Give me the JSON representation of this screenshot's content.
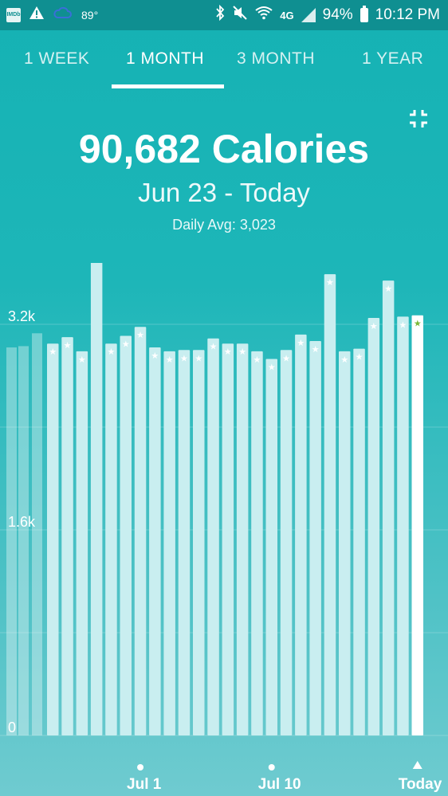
{
  "status_bar": {
    "imdb_label": "IMDb",
    "temperature": "89°",
    "network": "4G",
    "battery": "94%",
    "time": "10:12 PM"
  },
  "tabs": [
    {
      "label": "1 WEEK",
      "active": false
    },
    {
      "label": "1 MONTH",
      "active": true
    },
    {
      "label": "3 MONTH",
      "active": false
    },
    {
      "label": "1 YEAR",
      "active": false
    }
  ],
  "summary": {
    "total": "90,682 Calories",
    "range": "Jun 23 - Today",
    "daily_avg_label": "Daily Avg:",
    "daily_avg_value": "3,023"
  },
  "colors": {
    "accent": "#15b2b4",
    "bar": "#c9eef0",
    "today_bar": "#ffffff",
    "star_today": "#7ab836"
  },
  "chart_data": {
    "type": "bar",
    "y_ticks": [
      {
        "label": "3.2k",
        "value": 3200
      },
      {
        "label": "1.6k",
        "value": 1600
      },
      {
        "label": "0",
        "value": 0
      }
    ],
    "x_labels": [
      {
        "label": "Jul 1",
        "index": 6
      },
      {
        "label": "Jul 10",
        "index": 15
      },
      {
        "label": "Today",
        "index": 25
      }
    ],
    "values": [
      3050,
      3100,
      2990,
      3830,
      3050,
      3110,
      3180,
      3020,
      2990,
      3000,
      3000,
      3090,
      3050,
      3050,
      2990,
      2930,
      3000,
      3120,
      3070,
      3590,
      2990,
      3010,
      3250,
      3540,
      3260,
      3270
    ],
    "ylim": [
      0,
      3900
    ],
    "goal_met": [
      true,
      true,
      true,
      true,
      true,
      true,
      true,
      true,
      true,
      true,
      true,
      true,
      true,
      true,
      true,
      true,
      true,
      true,
      true,
      true,
      true,
      true,
      true,
      true,
      true,
      true
    ]
  }
}
